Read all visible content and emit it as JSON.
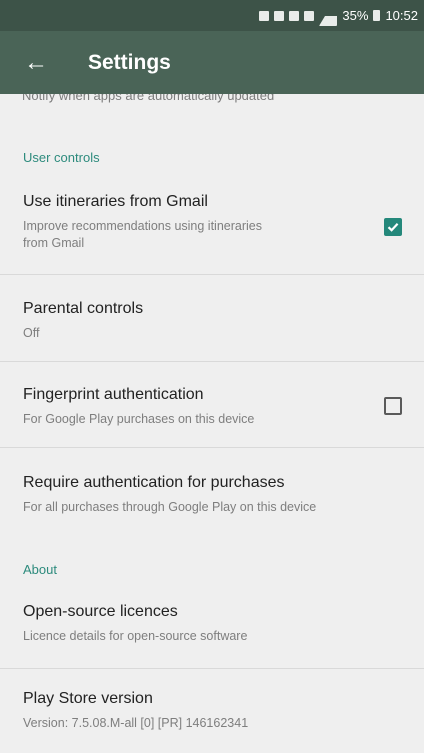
{
  "status_bar": {
    "battery": "35%",
    "time": "10:52"
  },
  "toolbar": {
    "back_icon": "arrow-left",
    "title": "Settings"
  },
  "clipped_text": "Notify when apps are automatically updated",
  "sections": {
    "user_controls": "User controls",
    "about": "About"
  },
  "items": {
    "itineraries": {
      "title": "Use itineraries from Gmail",
      "subtitle_line1": "Improve recommendations using itineraries",
      "subtitle_line2": "from Gmail",
      "checked": true
    },
    "parental": {
      "title": "Parental controls",
      "subtitle": "Off"
    },
    "fingerprint": {
      "title": "Fingerprint authentication",
      "subtitle": "For Google Play purchases on this device",
      "checked": false
    },
    "require_auth": {
      "title": "Require authentication for purchases",
      "subtitle": "For all purchases through Google Play on this device"
    },
    "licences": {
      "title": "Open-source licences",
      "subtitle": "Licence details for open-source software"
    },
    "version": {
      "title": "Play Store version",
      "subtitle": "Version: 7.5.08.M-all [0] [PR] 146162341"
    }
  },
  "colors": {
    "toolbar": "#4a6457",
    "status_bar": "#3d5348",
    "accent": "#24887b",
    "background": "#efefef"
  }
}
